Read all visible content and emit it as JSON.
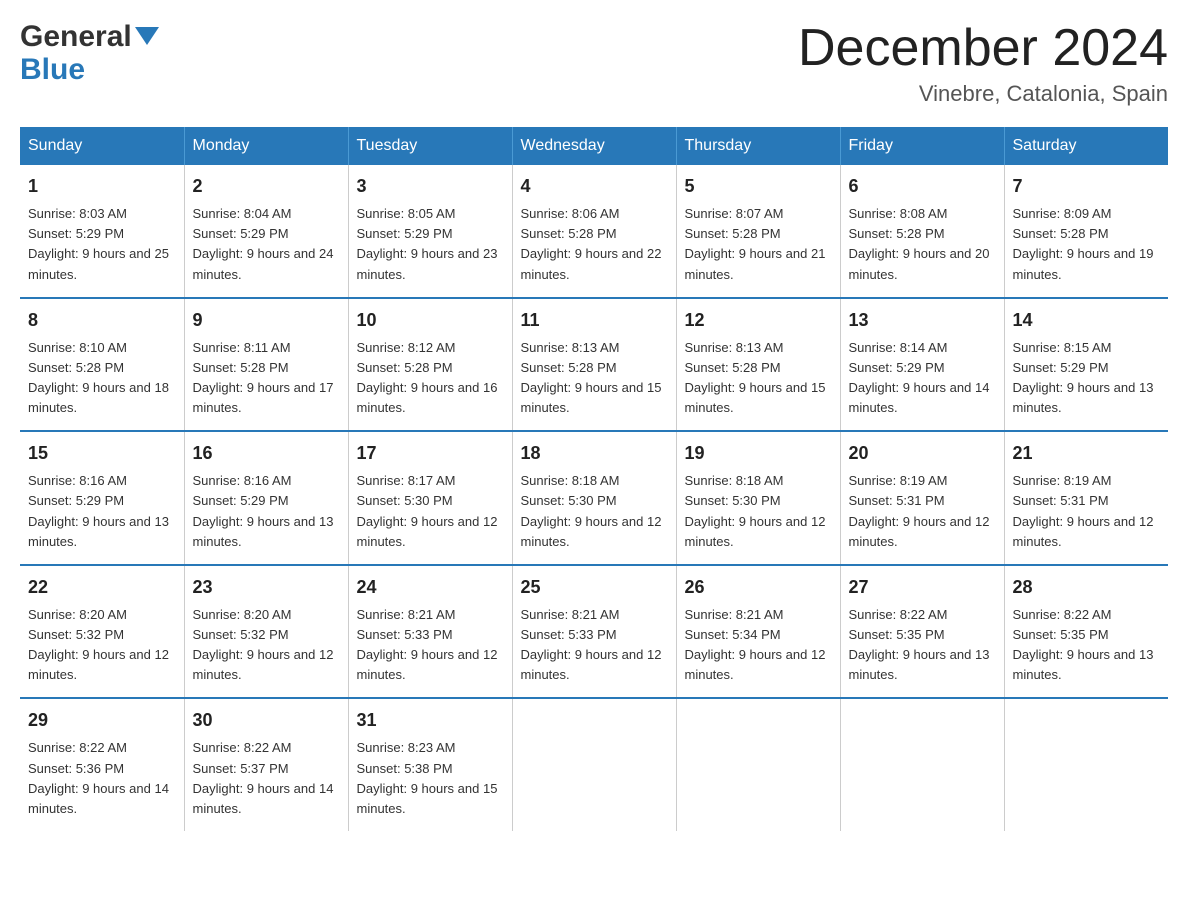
{
  "header": {
    "logo_general": "General",
    "logo_blue": "Blue",
    "title": "December 2024",
    "subtitle": "Vinebre, Catalonia, Spain"
  },
  "days_of_week": [
    "Sunday",
    "Monday",
    "Tuesday",
    "Wednesday",
    "Thursday",
    "Friday",
    "Saturday"
  ],
  "weeks": [
    [
      {
        "day": "1",
        "sunrise": "Sunrise: 8:03 AM",
        "sunset": "Sunset: 5:29 PM",
        "daylight": "Daylight: 9 hours and 25 minutes."
      },
      {
        "day": "2",
        "sunrise": "Sunrise: 8:04 AM",
        "sunset": "Sunset: 5:29 PM",
        "daylight": "Daylight: 9 hours and 24 minutes."
      },
      {
        "day": "3",
        "sunrise": "Sunrise: 8:05 AM",
        "sunset": "Sunset: 5:29 PM",
        "daylight": "Daylight: 9 hours and 23 minutes."
      },
      {
        "day": "4",
        "sunrise": "Sunrise: 8:06 AM",
        "sunset": "Sunset: 5:28 PM",
        "daylight": "Daylight: 9 hours and 22 minutes."
      },
      {
        "day": "5",
        "sunrise": "Sunrise: 8:07 AM",
        "sunset": "Sunset: 5:28 PM",
        "daylight": "Daylight: 9 hours and 21 minutes."
      },
      {
        "day": "6",
        "sunrise": "Sunrise: 8:08 AM",
        "sunset": "Sunset: 5:28 PM",
        "daylight": "Daylight: 9 hours and 20 minutes."
      },
      {
        "day": "7",
        "sunrise": "Sunrise: 8:09 AM",
        "sunset": "Sunset: 5:28 PM",
        "daylight": "Daylight: 9 hours and 19 minutes."
      }
    ],
    [
      {
        "day": "8",
        "sunrise": "Sunrise: 8:10 AM",
        "sunset": "Sunset: 5:28 PM",
        "daylight": "Daylight: 9 hours and 18 minutes."
      },
      {
        "day": "9",
        "sunrise": "Sunrise: 8:11 AM",
        "sunset": "Sunset: 5:28 PM",
        "daylight": "Daylight: 9 hours and 17 minutes."
      },
      {
        "day": "10",
        "sunrise": "Sunrise: 8:12 AM",
        "sunset": "Sunset: 5:28 PM",
        "daylight": "Daylight: 9 hours and 16 minutes."
      },
      {
        "day": "11",
        "sunrise": "Sunrise: 8:13 AM",
        "sunset": "Sunset: 5:28 PM",
        "daylight": "Daylight: 9 hours and 15 minutes."
      },
      {
        "day": "12",
        "sunrise": "Sunrise: 8:13 AM",
        "sunset": "Sunset: 5:28 PM",
        "daylight": "Daylight: 9 hours and 15 minutes."
      },
      {
        "day": "13",
        "sunrise": "Sunrise: 8:14 AM",
        "sunset": "Sunset: 5:29 PM",
        "daylight": "Daylight: 9 hours and 14 minutes."
      },
      {
        "day": "14",
        "sunrise": "Sunrise: 8:15 AM",
        "sunset": "Sunset: 5:29 PM",
        "daylight": "Daylight: 9 hours and 13 minutes."
      }
    ],
    [
      {
        "day": "15",
        "sunrise": "Sunrise: 8:16 AM",
        "sunset": "Sunset: 5:29 PM",
        "daylight": "Daylight: 9 hours and 13 minutes."
      },
      {
        "day": "16",
        "sunrise": "Sunrise: 8:16 AM",
        "sunset": "Sunset: 5:29 PM",
        "daylight": "Daylight: 9 hours and 13 minutes."
      },
      {
        "day": "17",
        "sunrise": "Sunrise: 8:17 AM",
        "sunset": "Sunset: 5:30 PM",
        "daylight": "Daylight: 9 hours and 12 minutes."
      },
      {
        "day": "18",
        "sunrise": "Sunrise: 8:18 AM",
        "sunset": "Sunset: 5:30 PM",
        "daylight": "Daylight: 9 hours and 12 minutes."
      },
      {
        "day": "19",
        "sunrise": "Sunrise: 8:18 AM",
        "sunset": "Sunset: 5:30 PM",
        "daylight": "Daylight: 9 hours and 12 minutes."
      },
      {
        "day": "20",
        "sunrise": "Sunrise: 8:19 AM",
        "sunset": "Sunset: 5:31 PM",
        "daylight": "Daylight: 9 hours and 12 minutes."
      },
      {
        "day": "21",
        "sunrise": "Sunrise: 8:19 AM",
        "sunset": "Sunset: 5:31 PM",
        "daylight": "Daylight: 9 hours and 12 minutes."
      }
    ],
    [
      {
        "day": "22",
        "sunrise": "Sunrise: 8:20 AM",
        "sunset": "Sunset: 5:32 PM",
        "daylight": "Daylight: 9 hours and 12 minutes."
      },
      {
        "day": "23",
        "sunrise": "Sunrise: 8:20 AM",
        "sunset": "Sunset: 5:32 PM",
        "daylight": "Daylight: 9 hours and 12 minutes."
      },
      {
        "day": "24",
        "sunrise": "Sunrise: 8:21 AM",
        "sunset": "Sunset: 5:33 PM",
        "daylight": "Daylight: 9 hours and 12 minutes."
      },
      {
        "day": "25",
        "sunrise": "Sunrise: 8:21 AM",
        "sunset": "Sunset: 5:33 PM",
        "daylight": "Daylight: 9 hours and 12 minutes."
      },
      {
        "day": "26",
        "sunrise": "Sunrise: 8:21 AM",
        "sunset": "Sunset: 5:34 PM",
        "daylight": "Daylight: 9 hours and 12 minutes."
      },
      {
        "day": "27",
        "sunrise": "Sunrise: 8:22 AM",
        "sunset": "Sunset: 5:35 PM",
        "daylight": "Daylight: 9 hours and 13 minutes."
      },
      {
        "day": "28",
        "sunrise": "Sunrise: 8:22 AM",
        "sunset": "Sunset: 5:35 PM",
        "daylight": "Daylight: 9 hours and 13 minutes."
      }
    ],
    [
      {
        "day": "29",
        "sunrise": "Sunrise: 8:22 AM",
        "sunset": "Sunset: 5:36 PM",
        "daylight": "Daylight: 9 hours and 14 minutes."
      },
      {
        "day": "30",
        "sunrise": "Sunrise: 8:22 AM",
        "sunset": "Sunset: 5:37 PM",
        "daylight": "Daylight: 9 hours and 14 minutes."
      },
      {
        "day": "31",
        "sunrise": "Sunrise: 8:23 AM",
        "sunset": "Sunset: 5:38 PM",
        "daylight": "Daylight: 9 hours and 15 minutes."
      },
      null,
      null,
      null,
      null
    ]
  ]
}
